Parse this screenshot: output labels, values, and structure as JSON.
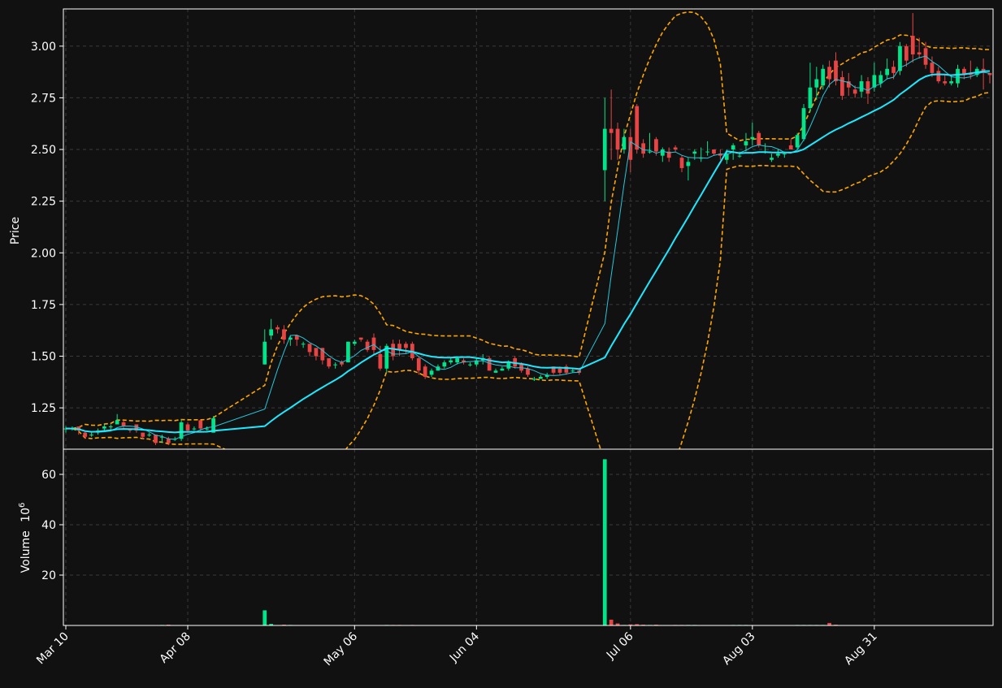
{
  "chart_data": {
    "type": "candlestick",
    "panels": {
      "price": {
        "ylabel": "Price",
        "ylim": [
          1.05,
          3.18
        ],
        "yticks": [
          "1.25",
          "1.50",
          "1.75",
          "2.00",
          "2.25",
          "2.50",
          "2.75",
          "3.00"
        ],
        "grid": true
      },
      "volume": {
        "ylabel": "Volume",
        "ylabel_exponent": "10",
        "ylabel_exponent_power": "6",
        "ylim": [
          0,
          70
        ],
        "yticks": [
          "20",
          "40",
          "60"
        ],
        "grid": true
      }
    },
    "x_ticks": [
      "Mar 10",
      "Apr 08",
      "May 06",
      "Jun 04",
      "Jul 06",
      "Aug 03",
      "Aug 31"
    ],
    "colors": {
      "up": "#00e58a",
      "down": "#e84444",
      "ma_fast": "#26c6da",
      "ma_slow": "#1ee8ff",
      "bands": "#ffa500",
      "background": "#111111",
      "grid": "#3a3a3a",
      "axes": "#ffffff"
    },
    "price_series": [
      [
        1.15,
        1.15,
        1.13,
        1.16
      ],
      [
        1.15,
        1.15,
        1.14,
        1.16
      ],
      [
        1.16,
        1.14,
        1.12,
        1.16
      ],
      [
        1.13,
        1.11,
        1.1,
        1.14
      ],
      [
        1.12,
        1.12,
        1.11,
        1.13
      ],
      [
        1.13,
        1.14,
        1.12,
        1.15
      ],
      [
        1.15,
        1.16,
        1.14,
        1.17
      ],
      [
        1.16,
        1.16,
        1.14,
        1.17
      ],
      [
        1.17,
        1.19,
        1.17,
        1.22
      ],
      [
        1.18,
        1.16,
        1.15,
        1.19
      ],
      [
        1.15,
        1.14,
        1.13,
        1.15
      ],
      [
        1.17,
        1.14,
        1.13,
        1.17
      ],
      [
        1.13,
        1.11,
        1.1,
        1.13
      ],
      [
        1.12,
        1.12,
        1.11,
        1.13
      ],
      [
        1.12,
        1.08,
        1.07,
        1.12
      ],
      [
        1.11,
        1.11,
        1.08,
        1.12
      ],
      [
        1.1,
        1.08,
        1.07,
        1.11
      ],
      [
        1.1,
        1.1,
        1.09,
        1.11
      ],
      [
        1.1,
        1.18,
        1.09,
        1.19
      ],
      [
        1.17,
        1.14,
        1.13,
        1.18
      ],
      [
        1.15,
        1.15,
        1.14,
        1.16
      ],
      [
        1.19,
        1.15,
        1.13,
        1.19
      ],
      [
        1.15,
        1.15,
        1.14,
        1.16
      ],
      [
        1.13,
        1.2,
        1.13,
        1.21
      ],
      [
        1.46,
        1.57,
        1.46,
        1.63
      ],
      [
        1.6,
        1.63,
        1.58,
        1.68
      ],
      [
        1.64,
        1.63,
        1.61,
        1.65
      ],
      [
        1.63,
        1.58,
        1.56,
        1.65
      ],
      [
        1.58,
        1.59,
        1.55,
        1.6
      ],
      [
        1.6,
        1.58,
        1.55,
        1.6
      ],
      [
        1.56,
        1.56,
        1.54,
        1.57
      ],
      [
        1.56,
        1.52,
        1.5,
        1.56
      ],
      [
        1.54,
        1.5,
        1.48,
        1.54
      ],
      [
        1.54,
        1.48,
        1.46,
        1.54
      ],
      [
        1.49,
        1.45,
        1.44,
        1.49
      ],
      [
        1.46,
        1.46,
        1.44,
        1.47
      ],
      [
        1.47,
        1.46,
        1.45,
        1.48
      ],
      [
        1.47,
        1.57,
        1.47,
        1.57
      ],
      [
        1.56,
        1.57,
        1.55,
        1.58
      ],
      [
        1.59,
        1.58,
        1.57,
        1.59
      ],
      [
        1.57,
        1.53,
        1.52,
        1.58
      ],
      [
        1.59,
        1.53,
        1.51,
        1.61
      ],
      [
        1.51,
        1.44,
        1.43,
        1.55
      ],
      [
        1.44,
        1.55,
        1.42,
        1.56
      ],
      [
        1.56,
        1.5,
        1.48,
        1.58
      ],
      [
        1.56,
        1.53,
        1.5,
        1.58
      ],
      [
        1.56,
        1.54,
        1.51,
        1.57
      ],
      [
        1.56,
        1.49,
        1.48,
        1.57
      ],
      [
        1.49,
        1.43,
        1.41,
        1.5
      ],
      [
        1.45,
        1.4,
        1.39,
        1.46
      ],
      [
        1.41,
        1.43,
        1.4,
        1.44
      ],
      [
        1.43,
        1.45,
        1.43,
        1.46
      ],
      [
        1.45,
        1.47,
        1.44,
        1.48
      ],
      [
        1.47,
        1.48,
        1.46,
        1.49
      ],
      [
        1.47,
        1.49,
        1.46,
        1.5
      ],
      [
        1.48,
        1.47,
        1.46,
        1.49
      ],
      [
        1.46,
        1.46,
        1.45,
        1.47
      ],
      [
        1.46,
        1.48,
        1.45,
        1.49
      ],
      [
        1.48,
        1.49,
        1.46,
        1.51
      ],
      [
        1.49,
        1.43,
        1.43,
        1.5
      ],
      [
        1.42,
        1.43,
        1.42,
        1.44
      ],
      [
        1.43,
        1.44,
        1.43,
        1.45
      ],
      [
        1.44,
        1.47,
        1.43,
        1.48
      ],
      [
        1.49,
        1.45,
        1.44,
        1.5
      ],
      [
        1.46,
        1.43,
        1.42,
        1.47
      ],
      [
        1.44,
        1.41,
        1.4,
        1.45
      ],
      [
        1.39,
        1.39,
        1.38,
        1.4
      ],
      [
        1.39,
        1.4,
        1.39,
        1.41
      ],
      [
        1.4,
        1.41,
        1.39,
        1.42
      ],
      [
        1.45,
        1.42,
        1.41,
        1.45
      ],
      [
        1.44,
        1.42,
        1.41,
        1.45
      ],
      [
        1.45,
        1.42,
        1.41,
        1.46
      ],
      [
        1.43,
        1.43,
        1.42,
        1.44
      ],
      [
        1.43,
        1.42,
        1.41,
        1.44
      ],
      [
        2.4,
        2.6,
        2.25,
        2.75
      ],
      [
        2.6,
        2.58,
        2.45,
        2.79
      ],
      [
        2.6,
        2.5,
        2.45,
        2.63
      ],
      [
        2.5,
        2.56,
        2.48,
        2.6
      ],
      [
        2.56,
        2.45,
        2.39,
        2.6
      ],
      [
        2.71,
        2.5,
        2.48,
        2.72
      ],
      [
        2.53,
        2.48,
        2.46,
        2.55
      ],
      [
        2.49,
        2.49,
        2.48,
        2.58
      ],
      [
        2.55,
        2.49,
        2.47,
        2.56
      ],
      [
        2.47,
        2.5,
        2.44,
        2.51
      ],
      [
        2.49,
        2.46,
        2.44,
        2.51
      ],
      [
        2.51,
        2.5,
        2.49,
        2.52
      ],
      [
        2.46,
        2.41,
        2.39,
        2.47
      ],
      [
        2.42,
        2.44,
        2.35,
        2.46
      ],
      [
        2.48,
        2.49,
        2.45,
        2.5
      ],
      [
        2.46,
        2.46,
        2.44,
        2.51
      ],
      [
        2.49,
        2.49,
        2.47,
        2.54
      ],
      [
        2.5,
        2.48,
        2.47,
        2.5
      ],
      [
        2.48,
        2.47,
        2.45,
        2.5
      ],
      [
        2.45,
        2.48,
        2.43,
        2.5
      ],
      [
        2.5,
        2.52,
        2.45,
        2.53
      ],
      [
        2.47,
        2.47,
        2.46,
        2.49
      ],
      [
        2.52,
        2.54,
        2.49,
        2.58
      ],
      [
        2.55,
        2.56,
        2.52,
        2.63
      ],
      [
        2.58,
        2.52,
        2.51,
        2.59
      ],
      [
        2.49,
        2.49,
        2.48,
        2.53
      ],
      [
        2.45,
        2.46,
        2.44,
        2.48
      ],
      [
        2.47,
        2.48,
        2.46,
        2.5
      ],
      [
        2.48,
        2.48,
        2.46,
        2.49
      ],
      [
        2.52,
        2.5,
        2.5,
        2.55
      ],
      [
        2.51,
        2.57,
        2.5,
        2.58
      ],
      [
        2.55,
        2.7,
        2.54,
        2.72
      ],
      [
        2.7,
        2.8,
        2.68,
        2.92
      ],
      [
        2.8,
        2.84,
        2.74,
        2.9
      ],
      [
        2.81,
        2.89,
        2.79,
        2.91
      ],
      [
        2.9,
        2.84,
        2.8,
        2.93
      ],
      [
        2.93,
        2.83,
        2.81,
        2.97
      ],
      [
        2.85,
        2.76,
        2.74,
        2.88
      ],
      [
        2.83,
        2.8,
        2.76,
        2.87
      ],
      [
        2.79,
        2.77,
        2.75,
        2.81
      ],
      [
        2.78,
        2.83,
        2.75,
        2.86
      ],
      [
        2.83,
        2.77,
        2.72,
        2.85
      ],
      [
        2.8,
        2.86,
        2.78,
        2.92
      ],
      [
        2.82,
        2.86,
        2.8,
        2.88
      ],
      [
        2.86,
        2.89,
        2.84,
        2.94
      ],
      [
        2.9,
        2.87,
        2.84,
        2.93
      ],
      [
        2.88,
        3.0,
        2.86,
        3.02
      ],
      [
        3.0,
        2.93,
        2.9,
        3.01
      ],
      [
        3.05,
        2.96,
        2.92,
        3.16
      ],
      [
        2.97,
        2.96,
        2.94,
        3.04
      ],
      [
        2.99,
        2.91,
        2.89,
        3.02
      ],
      [
        2.92,
        2.87,
        2.85,
        2.95
      ],
      [
        2.88,
        2.83,
        2.82,
        2.9
      ],
      [
        2.83,
        2.82,
        2.81,
        2.86
      ],
      [
        2.82,
        2.83,
        2.81,
        2.86
      ],
      [
        2.82,
        2.89,
        2.8,
        2.91
      ],
      [
        2.89,
        2.86,
        2.84,
        2.9
      ],
      [
        2.87,
        2.86,
        2.84,
        2.93
      ],
      [
        2.86,
        2.89,
        2.85,
        2.9
      ],
      [
        2.89,
        2.87,
        2.79,
        2.94
      ],
      [
        2.87,
        2.86,
        2.82,
        2.87
      ]
    ],
    "volume_series": [
      0.05,
      0.05,
      0.05,
      0.05,
      0.05,
      0.05,
      0.05,
      0.05,
      0.05,
      0.05,
      0.05,
      0.05,
      0.05,
      0.05,
      0.05,
      0.2,
      0.3,
      0.05,
      0.05,
      0.05,
      0.05,
      0.05,
      0.05,
      0.05,
      6.0,
      0.6,
      0.1,
      0.3,
      0.2,
      0.05,
      0.05,
      0.05,
      0.05,
      0.05,
      0.05,
      0.05,
      0.05,
      0.05,
      0.05,
      0.05,
      0.05,
      0.05,
      0.05,
      0.2,
      0.2,
      0.2,
      0.1,
      0.2,
      0.05,
      0.05,
      0.05,
      0.05,
      0.05,
      0.05,
      0.05,
      0.05,
      0.05,
      0.05,
      0.05,
      0.05,
      0.05,
      0.05,
      0.05,
      0.05,
      0.05,
      0.05,
      0.05,
      0.05,
      0.05,
      0.05,
      0.05,
      0.05,
      0.05,
      0.05,
      66.0,
      2.3,
      0.8,
      0.2,
      0.4,
      0.5,
      0.3,
      0.2,
      0.3,
      0.05,
      0.05,
      0.2,
      0.2,
      0.2,
      0.2,
      0.05,
      0.05,
      0.05,
      0.05,
      0.05,
      0.2,
      0.2,
      0.2,
      0.05,
      0.05,
      0.05,
      0.05,
      0.05,
      0.05,
      0.05,
      0.2,
      0.2,
      0.2,
      0.2,
      0.2,
      1.0,
      0.3,
      0.1,
      0.05,
      0.05,
      0.05,
      0.05,
      0.05,
      0.05,
      0.05,
      0.05,
      0.05,
      0.05,
      0.05,
      0.05,
      0.05,
      0.05,
      0.05,
      0.05,
      0.05,
      0.05,
      0.05,
      0.05,
      0.05,
      0.05
    ]
  }
}
